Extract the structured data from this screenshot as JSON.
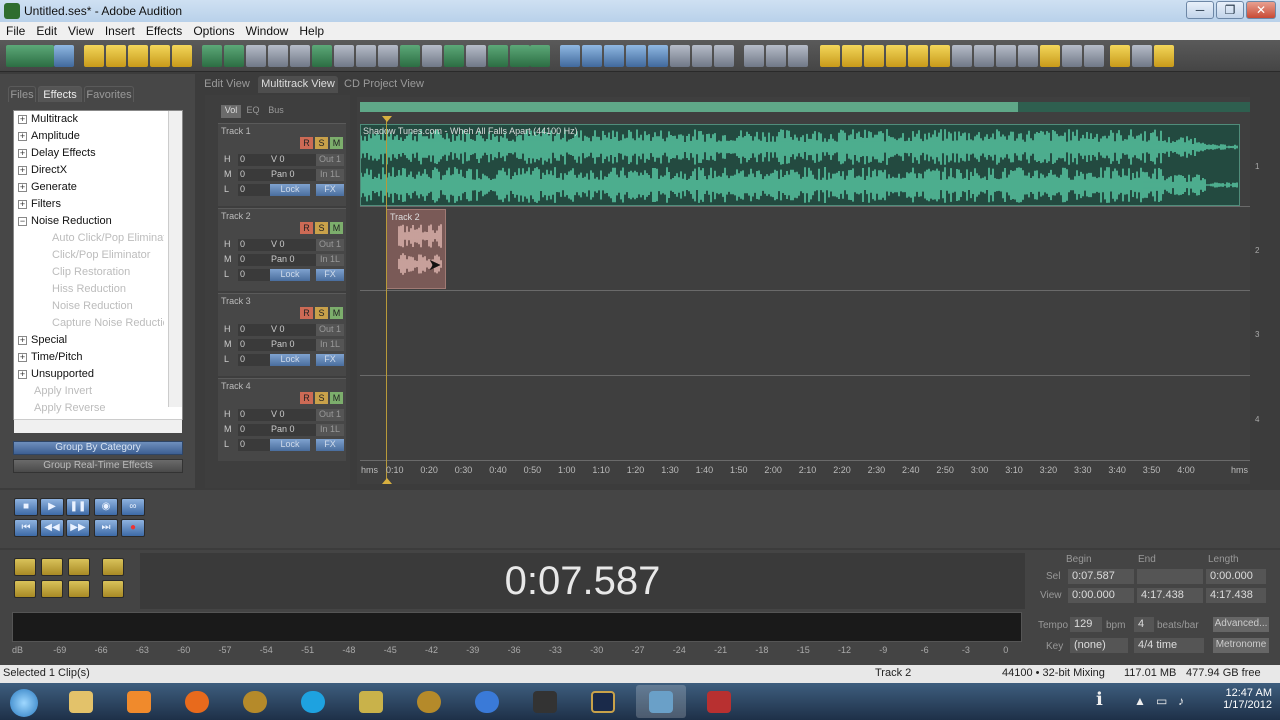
{
  "window": {
    "title": "Untitled.ses* - Adobe Audition",
    "min": "─",
    "max": "❐",
    "close": "✕"
  },
  "menu": [
    "File",
    "Edit",
    "View",
    "Insert",
    "Effects",
    "Options",
    "Window",
    "Help"
  ],
  "left_tabs": [
    "Files",
    "Effects",
    "Favorites"
  ],
  "effects_list": [
    {
      "label": "Multitrack",
      "type": "plus"
    },
    {
      "label": "Amplitude",
      "type": "plus"
    },
    {
      "label": "Delay Effects",
      "type": "plus"
    },
    {
      "label": "DirectX",
      "type": "plus"
    },
    {
      "label": "Generate",
      "type": "plus"
    },
    {
      "label": "Filters",
      "type": "plus"
    },
    {
      "label": "Noise Reduction",
      "type": "minus"
    },
    {
      "label": "Auto Click/Pop Eliminator",
      "type": "child"
    },
    {
      "label": "Click/Pop Eliminator",
      "type": "child"
    },
    {
      "label": "Clip Restoration",
      "type": "child"
    },
    {
      "label": "Hiss Reduction",
      "type": "child"
    },
    {
      "label": "Noise Reduction",
      "type": "child"
    },
    {
      "label": "Capture Noise Reduction",
      "type": "child"
    },
    {
      "label": "Special",
      "type": "plus"
    },
    {
      "label": "Time/Pitch",
      "type": "plus"
    },
    {
      "label": "Unsupported",
      "type": "plus"
    },
    {
      "label": "Apply Invert",
      "type": "disabled"
    },
    {
      "label": "Apply Reverse",
      "type": "disabled"
    }
  ],
  "group_buttons": [
    "Group By Category",
    "Group Real-Time Effects"
  ],
  "view_tabs": [
    "Edit View",
    "Multitrack View",
    "CD Project View"
  ],
  "track_tabs": [
    "Vol",
    "EQ",
    "Bus"
  ],
  "tracks": [
    {
      "name": "Track 1"
    },
    {
      "name": "Track 2"
    },
    {
      "name": "Track 3"
    },
    {
      "name": "Track 4"
    }
  ],
  "track_controls": {
    "r": "R",
    "s": "S",
    "m": "M",
    "h": "H",
    "hv": "0",
    "vol": "V 0",
    "out": "Out 1",
    "m_lbl": "M",
    "mv": "0",
    "pan": "Pan 0",
    "in": "In 1L",
    "l_lbl": "L",
    "lv": "0",
    "lock": "Lock",
    "fx": "FX"
  },
  "clips": {
    "clip1": "Shadow Tunes.com - Wheh All Falls Apart (44100 Hz)",
    "clip2": "Track 2"
  },
  "ruler": [
    "hms",
    "0:10",
    "0:20",
    "0:30",
    "0:40",
    "0:50",
    "1:00",
    "1:10",
    "1:20",
    "1:30",
    "1:40",
    "1:50",
    "2:00",
    "2:10",
    "2:20",
    "2:30",
    "2:40",
    "2:50",
    "3:00",
    "3:10",
    "3:20",
    "3:30",
    "3:40",
    "3:50",
    "4:00",
    "hms"
  ],
  "lane_numbers": [
    "1",
    "2",
    "3",
    "4"
  ],
  "time_display": "0:07.587",
  "sel_view": {
    "headers": [
      "Begin",
      "End",
      "Length"
    ],
    "sel_label": "Sel",
    "sel": [
      "0:07.587",
      "",
      "0:00.000"
    ],
    "view_label": "View",
    "view": [
      "0:00.000",
      "4:17.438",
      "4:17.438"
    ]
  },
  "tempo": {
    "label": "Tempo",
    "value": "129",
    "bpm": "bpm",
    "beats": "4",
    "beats_lbl": "beats/bar",
    "advanced": "Advanced...",
    "key_label": "Key",
    "key": "(none)",
    "time_sig": "4/4 time",
    "metronome": "Metronome"
  },
  "meter_labels": [
    "dB",
    "-69",
    "-66",
    "-63",
    "-60",
    "-57",
    "-54",
    "-51",
    "-48",
    "-45",
    "-42",
    "-39",
    "-36",
    "-33",
    "-30",
    "-27",
    "-24",
    "-21",
    "-18",
    "-15",
    "-12",
    "-9",
    "-6",
    "-3",
    "0"
  ],
  "status": {
    "left": "Selected 1 Clip(s)",
    "track": "Track 2",
    "format": "44100 • 32-bit Mixing",
    "size": "117.01 MB",
    "free": "477.94 GB free"
  },
  "clock": {
    "time": "12:47 AM",
    "date": "1/17/2012"
  }
}
